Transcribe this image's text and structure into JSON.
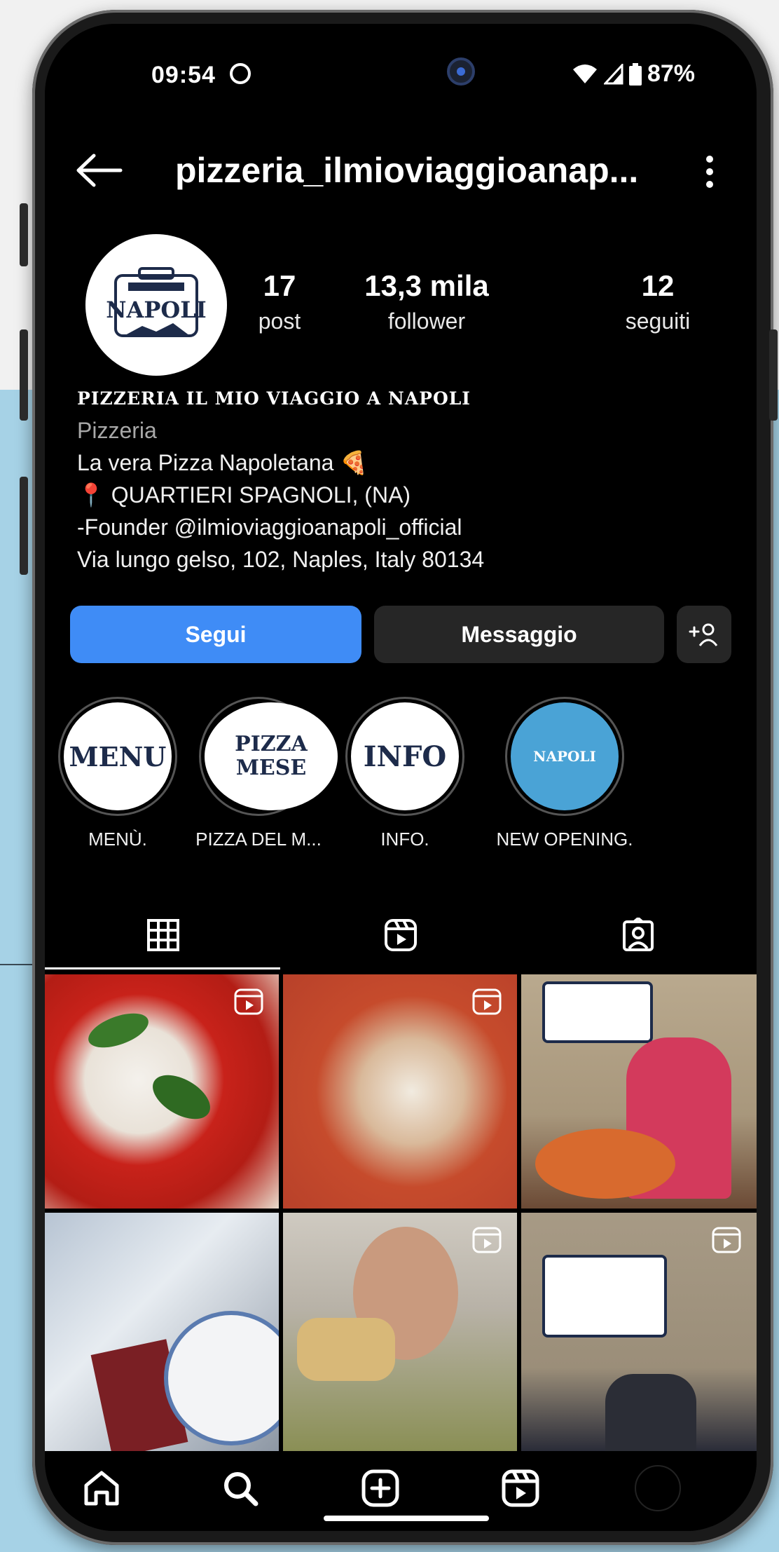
{
  "status_bar": {
    "time": "09:54",
    "battery": "87%"
  },
  "header": {
    "username": "pizzeria_ilmioviaggioanap..."
  },
  "stats": {
    "posts_count": "17",
    "posts_label": "post",
    "followers_count": "13,3 mila",
    "followers_label": "follower",
    "following_count": "12",
    "following_label": "seguiti"
  },
  "bio": {
    "display_name": "PIZZERIA IL MIO VIAGGIO A NAPOLI",
    "category": "Pizzeria",
    "lines": [
      "La vera Pizza Napoletana 🍕",
      "📍 QUARTIERI SPAGNOLI, (NA)",
      "-Founder @ilmioviaggioanapoli_official",
      "Via lungo gelso, 102, Naples, Italy 80134"
    ]
  },
  "actions": {
    "follow_label": "Segui",
    "message_label": "Messaggio"
  },
  "highlights": [
    {
      "label": "MENÙ.",
      "art": "MENU"
    },
    {
      "label": "PIZZA DEL M...",
      "art": "PIZZA MESE"
    },
    {
      "label": "INFO.",
      "art": "INFO"
    },
    {
      "label": "NEW OPENING.",
      "art": "NAPOLI"
    }
  ],
  "avatar": {
    "logo_text": "NAPOLI"
  },
  "colors": {
    "accent_blue": "#3f8cf6",
    "secondary_button": "#262626",
    "background": "#000000"
  },
  "icons": {
    "back": "arrow-left-icon",
    "more": "vertical-dots-icon",
    "grid_tab": "grid-icon",
    "reels_tab": "reels-icon",
    "tagged_tab": "tagged-icon",
    "nav": [
      "home-icon",
      "search-icon",
      "plus-square-icon",
      "reels-icon",
      "profile-avatar"
    ]
  }
}
